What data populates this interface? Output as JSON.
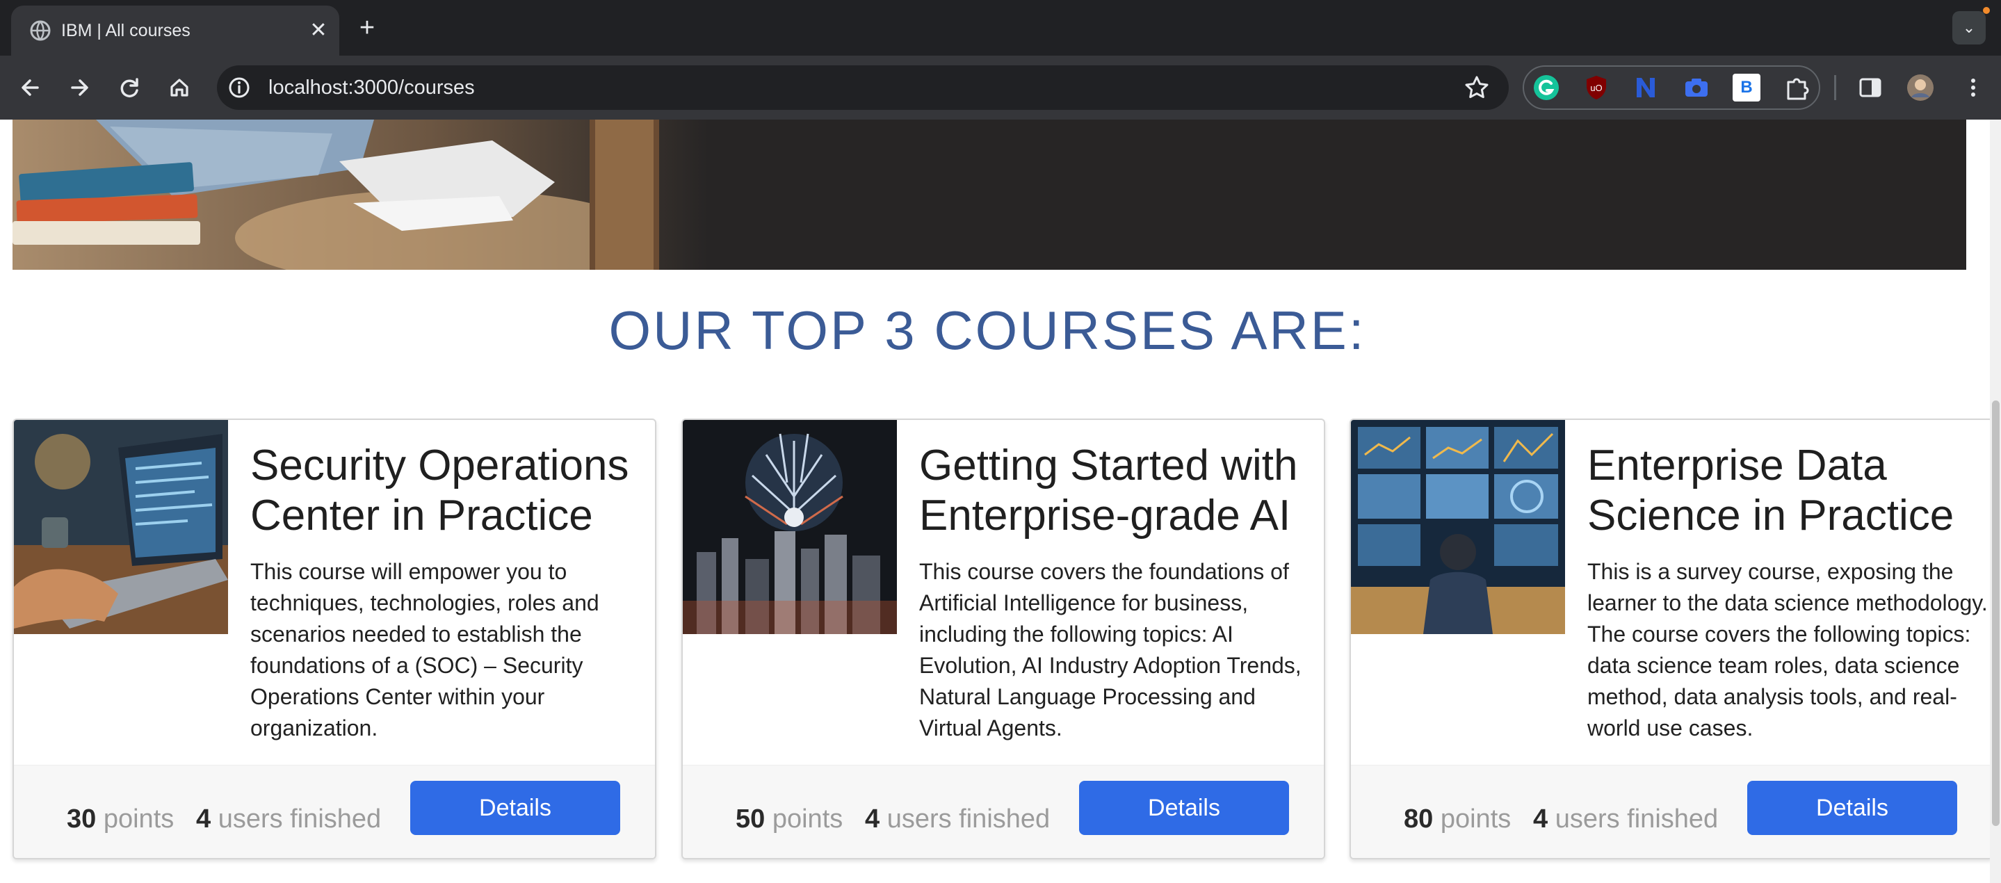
{
  "browser": {
    "tab_title": "IBM | All courses",
    "url": "localhost:3000/courses",
    "extension_b_label": "B"
  },
  "page": {
    "section_title": "OUR TOP 3 COURSES ARE:"
  },
  "courses": [
    {
      "title": "Security Operations Center in Practice",
      "description": "This course will empower you to techniques, technologies, roles and scenarios needed to establish the foundations of a (SOC) – Security Operations Center within your organization.",
      "points": "30",
      "points_label": "points",
      "finished": "4",
      "finished_label": "users finished",
      "button": "Details"
    },
    {
      "title": "Getting Started with Enterprise-grade AI",
      "description": "This course covers the foundations of Artificial Intelligence for business, including the following topics: AI Evolution, AI Industry Adoption Trends, Natural Language Processing and Virtual Agents.",
      "points": "50",
      "points_label": "points",
      "finished": "4",
      "finished_label": "users finished",
      "button": "Details"
    },
    {
      "title": "Enterprise Data Science in Practice",
      "description": "This is a survey course, exposing the learner to the data science methodology. The course covers the following topics: data science team roles, data science method, data analysis tools, and real-world use cases.",
      "points": "80",
      "points_label": "points",
      "finished": "4",
      "finished_label": "users finished",
      "button": "Details"
    }
  ],
  "colors": {
    "accent": "#2f6be6",
    "title_blue": "#3b5b96",
    "hero_bg": "#272525"
  }
}
